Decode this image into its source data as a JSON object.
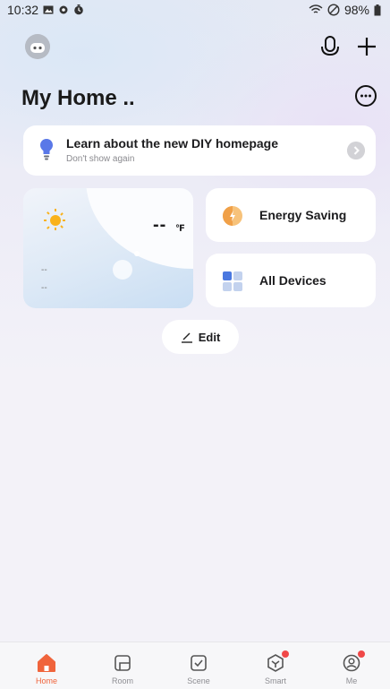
{
  "status_bar": {
    "time": "10:32",
    "battery": "98%"
  },
  "header": {
    "home_name": "My Home .."
  },
  "banner": {
    "title": "Learn about the new DIY homepage",
    "subtitle": "Don't show again"
  },
  "weather": {
    "temperature": "--",
    "unit": "℉",
    "line1": "--",
    "line2": "--"
  },
  "cards": {
    "energy_label": "Energy Saving",
    "devices_label": "All Devices"
  },
  "edit_label": "Edit",
  "nav": {
    "items": [
      {
        "label": "Home",
        "icon": "home-icon",
        "active": true
      },
      {
        "label": "Room",
        "icon": "room-icon",
        "active": false
      },
      {
        "label": "Scene",
        "icon": "scene-icon",
        "active": false
      },
      {
        "label": "Smart",
        "icon": "smart-icon",
        "active": false
      },
      {
        "label": "Me",
        "icon": "profile-icon",
        "active": false
      }
    ]
  },
  "colors": {
    "accent": "#f0643c",
    "badge": "#f04848",
    "sun": "#f9b21c"
  }
}
